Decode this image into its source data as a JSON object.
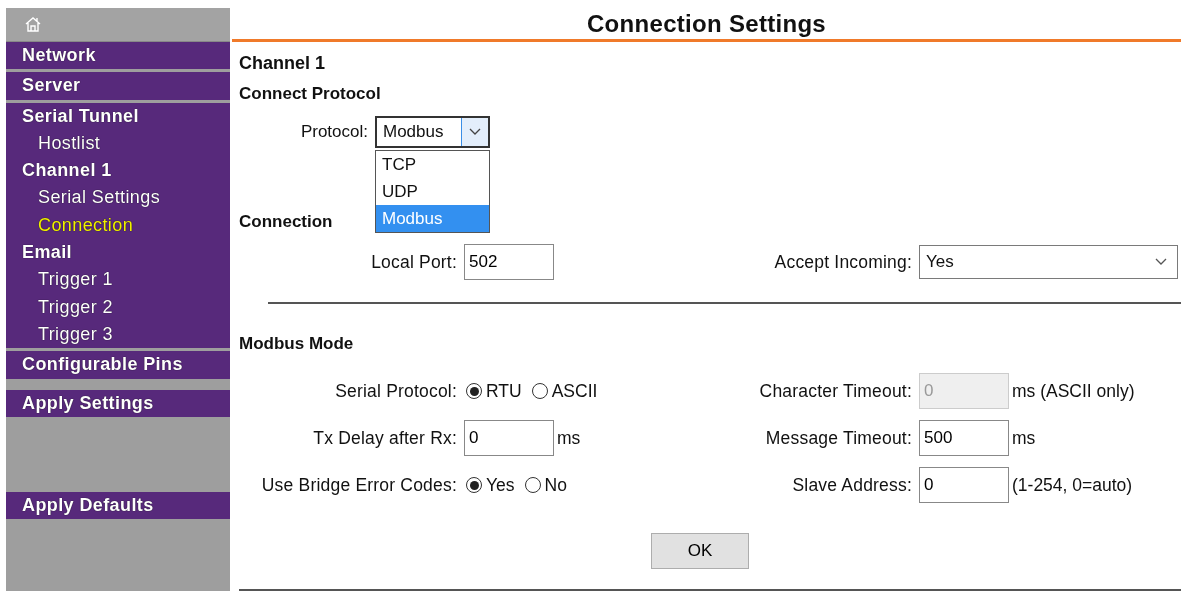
{
  "sidebar": {
    "groups": [
      {
        "items": [
          {
            "label": "Network",
            "selected": false
          }
        ]
      },
      {
        "items": [
          {
            "label": "Server",
            "selected": false
          }
        ]
      },
      {
        "items": [
          {
            "label": "Serial Tunnel",
            "selected": false,
            "children": [
              {
                "label": "Hostlist",
                "selected": false
              }
            ]
          },
          {
            "label": "Channel 1",
            "selected": false,
            "children": [
              {
                "label": "Serial Settings",
                "selected": false
              },
              {
                "label": "Connection",
                "selected": true
              }
            ]
          },
          {
            "label": "Email",
            "selected": false,
            "children": [
              {
                "label": "Trigger 1",
                "selected": false
              },
              {
                "label": "Trigger 2",
                "selected": false
              },
              {
                "label": "Trigger 3",
                "selected": false
              }
            ]
          }
        ]
      },
      {
        "items": [
          {
            "label": "Configurable Pins",
            "selected": false
          }
        ]
      }
    ],
    "actions": [
      {
        "label": "Apply Settings"
      },
      {
        "label": "Apply Defaults"
      }
    ]
  },
  "page": {
    "title": "Connection Settings",
    "channel": "Channel 1"
  },
  "connect_protocol": {
    "heading": "Connect Protocol",
    "field": {
      "kind": "select",
      "label": "Protocol:",
      "value": "Modbus",
      "expanded": true,
      "options": [
        {
          "label": "TCP",
          "selected": false
        },
        {
          "label": "UDP",
          "selected": false
        },
        {
          "label": "Modbus",
          "selected": true
        }
      ]
    }
  },
  "connection": {
    "heading": "Connection",
    "rows": [
      [
        {
          "kind": "text",
          "label": "Local Port:",
          "value": "502",
          "disabled": false
        },
        {
          "kind": "select",
          "label": "Accept Incoming:",
          "value": "Yes"
        }
      ]
    ]
  },
  "modbus_mode": {
    "heading": "Modbus Mode",
    "rows": [
      [
        {
          "kind": "radio",
          "label": "Serial Protocol:",
          "options": [
            {
              "label": "RTU",
              "selected": true
            },
            {
              "label": "ASCII",
              "selected": false
            }
          ]
        },
        {
          "kind": "text",
          "label": "Character Timeout:",
          "value": "0",
          "disabled": true,
          "unit": "ms (ASCII only)"
        }
      ],
      [
        {
          "kind": "text",
          "label": "Tx Delay after Rx:",
          "value": "0",
          "disabled": false,
          "unit": "ms"
        },
        {
          "kind": "text",
          "label": "Message Timeout:",
          "value": "500",
          "disabled": false,
          "unit": "ms"
        }
      ],
      [
        {
          "kind": "radio",
          "label": "Use Bridge Error Codes:",
          "options": [
            {
              "label": "Yes",
              "selected": true
            },
            {
              "label": "No",
              "selected": false
            }
          ]
        },
        {
          "kind": "text",
          "label": "Slave Address:",
          "value": "0",
          "disabled": false,
          "unit": "(1-254, 0=auto)"
        }
      ]
    ]
  },
  "ok_button": "OK"
}
